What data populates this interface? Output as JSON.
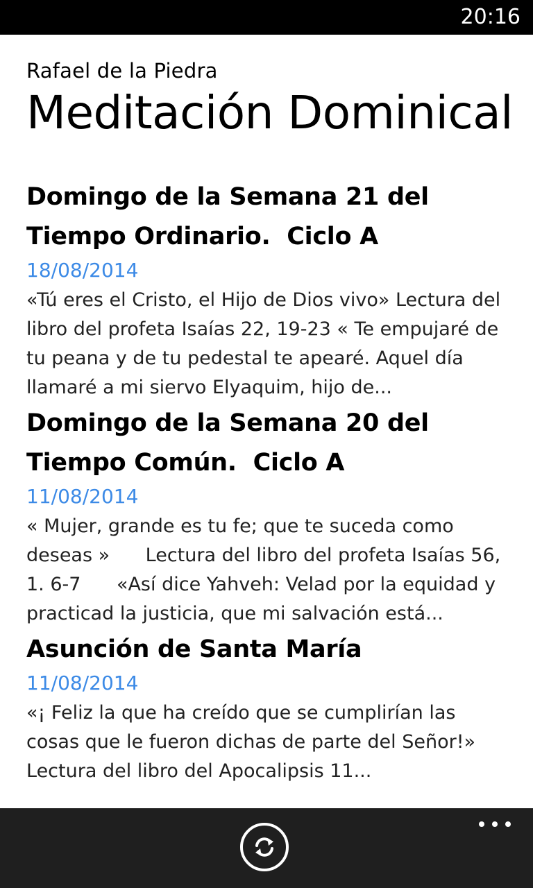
{
  "status_bar": {
    "time": "20:16"
  },
  "header": {
    "app_subtitle": "Rafael de la Piedra",
    "page_title": "Meditación Dominical"
  },
  "articles": [
    {
      "title": "Domingo de la Semana 21 del Tiempo Ordinario.  Ciclo A",
      "date": "18/08/2014",
      "excerpt": "«Tú eres el Cristo, el Hijo de Dios vivo» Lectura del libro del profeta Isaías 22, 19-23 « Te empujaré de tu peana y de tu pedestal te apearé. Aquel día llamaré a mi siervo Elyaquim, hijo de..."
    },
    {
      "title": "Domingo de la Semana 20 del Tiempo Común.  Ciclo A",
      "date": "11/08/2014",
      "excerpt": "« Mujer, grande es tu fe; que te suceda como deseas »      Lectura del libro del profeta Isaías 56, 1. 6-7      «Así dice Yahveh: Velad por la equidad y practicad la justicia, que mi salvación está..."
    },
    {
      "title": "Asunción de Santa María",
      "date": "11/08/2014",
      "excerpt": "«¡ Feliz la que ha creído que se cumplirían las cosas que le fueron dichas de parte del Señor!»      Lectura del libro del Apocalipsis 11..."
    }
  ],
  "app_bar": {
    "refresh_icon": "refresh-icon",
    "more_icon": "ellipsis-icon"
  },
  "colors": {
    "accent": "#3c8ae6",
    "app_bar_background": "#1f1f1f",
    "status_bar_background": "#000000"
  }
}
